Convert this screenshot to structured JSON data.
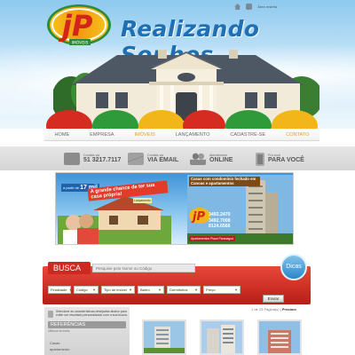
{
  "top_links": {
    "home_label": "Home",
    "login_label": "Área restrita"
  },
  "logo": {
    "letters": "jP",
    "subtext": "IMÓVEIS"
  },
  "brand": {
    "title": "Realizando Sonhos"
  },
  "nav": {
    "items": [
      {
        "label": "HOME",
        "active": false
      },
      {
        "label": "EMPRESA",
        "active": false
      },
      {
        "label": "IMÓVEIS",
        "active": true
      },
      {
        "label": "LANÇAMENTO",
        "active": false
      },
      {
        "label": "CADASTRE-SE",
        "active": false
      },
      {
        "label": "CONTATO",
        "active": false
      }
    ]
  },
  "contact": {
    "phone": {
      "small": "Contato via",
      "big": "51 3217.7117",
      "icon": "phone-icon"
    },
    "email": {
      "small": "Contato via",
      "big": "VIA EMAIL",
      "icon": "mail-icon"
    },
    "online": {
      "small": "Atendimento",
      "big": "ONLINE",
      "icon": "users-icon"
    },
    "app": {
      "small": "Pra você",
      "big": "PARA VOCÊ",
      "icon": "mobile-icon"
    }
  },
  "banner": {
    "left_caption": "A grande chance de ter sua casa própria!",
    "left_tag_small": "a partir de",
    "left_tag_big": "17 mil",
    "left_label": "Lançamento",
    "right_title": "Casas com condomínio fechado em Canoas e apartamentos",
    "right_phones": [
      "3492.2470",
      "3492.7008",
      "8124.6566"
    ],
    "right_footer": "Apartamentos Plaza Paranaguá"
  },
  "search": {
    "tab_label": "BUSCA",
    "query_placeholder": "Pesquise pelo Nome ou Código",
    "filters": [
      "Finalidade",
      "Código",
      "Tipo de imóvel",
      "Bairro",
      "Dormitórios",
      "Preço"
    ],
    "submit_label": "Enviar"
  },
  "dicas_label": "Dicas",
  "pagination": {
    "prefix": "1 de 23 Página(s) |",
    "next": "Próximo"
  },
  "sidebar": {
    "intro": "Selecione as características desejadas abaixo para exibir um resultado personalizado com a sua busca.",
    "title": "REFERÊNCIAS",
    "subtitle": "Últimos imóveis",
    "categories": [
      "Casas",
      "apartamento"
    ]
  },
  "colors": {
    "brand_blue": "#1e6fb3",
    "accent_orange": "#e89a18",
    "search_red": "#c9271e"
  }
}
